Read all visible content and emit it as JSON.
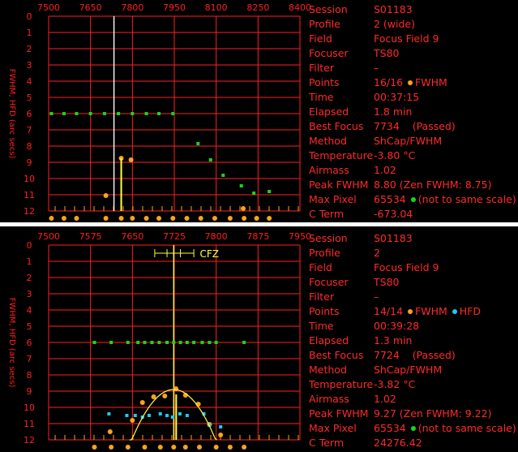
{
  "colors": {
    "grid": "#ff1f1f",
    "fwhm": "#ffa31a",
    "hfd": "#1ec8ff",
    "flux": "#19d619",
    "marker": "#ffff40",
    "focus_line": "#ffffff"
  },
  "top": {
    "info": [
      {
        "key": "Session",
        "val": "S01183"
      },
      {
        "key": "Profile",
        "val": "2 (wide)"
      },
      {
        "key": "Field",
        "val": "Focus Field 9"
      },
      {
        "key": "Focuser",
        "val": "TS80"
      },
      {
        "key": "Filter",
        "val": "–"
      },
      {
        "key": "Points",
        "val": "16/16",
        "legend1": "FWHM"
      },
      {
        "key": "Time",
        "val": "00:37:15"
      },
      {
        "key": "Elapsed",
        "val": "1.8 min"
      },
      {
        "key": "Best Focus",
        "val": "7734    (Passed)"
      },
      {
        "key": "Method",
        "val": "ShCap/FWHM"
      },
      {
        "key": "Temperature",
        "val": "-3.80 °C"
      },
      {
        "key": "Airmass",
        "val": "1.02"
      },
      {
        "key": "Peak FWHM",
        "val": "8.80 (Zen FWHM: 8.75)"
      },
      {
        "key": "Max Pixel",
        "val": "65534",
        "note": "(not to same scale)"
      },
      {
        "key": "C Term",
        "val": "-673.04"
      }
    ]
  },
  "bottom": {
    "info": [
      {
        "key": "Session",
        "val": "S01183"
      },
      {
        "key": "Profile",
        "val": "2"
      },
      {
        "key": "Field",
        "val": "Focus Field 9"
      },
      {
        "key": "Focuser",
        "val": "TS80"
      },
      {
        "key": "Filter",
        "val": "–"
      },
      {
        "key": "Points",
        "val": "14/14",
        "legend1": "FWHM",
        "legend2": "HFD"
      },
      {
        "key": "Time",
        "val": "00:39:28"
      },
      {
        "key": "Elapsed",
        "val": "1.3 min"
      },
      {
        "key": "Best Focus",
        "val": "7724    (Passed)"
      },
      {
        "key": "Method",
        "val": "ShCap/FWHM"
      },
      {
        "key": "Temperature",
        "val": "-3.82 °C"
      },
      {
        "key": "Airmass",
        "val": "1.02"
      },
      {
        "key": "Peak FWHM",
        "val": "9.27 (Zen FWHM: 9.22)"
      },
      {
        "key": "Max Pixel",
        "val": "65534",
        "note": "(not to same scale)"
      },
      {
        "key": "C Term",
        "val": "24276.42"
      }
    ]
  },
  "chart_data": [
    {
      "type": "scatter",
      "ylabel": "FWHM, HFD (arc secs)",
      "xlim": [
        7500,
        8400
      ],
      "xticks": [
        7500,
        7650,
        7800,
        7950,
        8100,
        8250,
        8400
      ],
      "ylim": [
        0,
        12
      ],
      "yticks": [
        0,
        1,
        2,
        3,
        4,
        5,
        6,
        7,
        8,
        9,
        10,
        11,
        12
      ],
      "best_focus": 7734,
      "series": [
        {
          "name": "FWHM",
          "points": [
            [
              7705,
              11.05
            ],
            [
              7760,
              8.75
            ],
            [
              7795,
              8.85
            ],
            [
              8197,
              11.85
            ]
          ]
        },
        {
          "name": "Flux",
          "points": [
            [
              7510,
              6
            ],
            [
              7555,
              6
            ],
            [
              7600,
              6
            ],
            [
              7650,
              6
            ],
            [
              7700,
              6
            ],
            [
              7750,
              6
            ],
            [
              7800,
              6
            ],
            [
              7850,
              6
            ],
            [
              7895,
              6
            ],
            [
              7945,
              6
            ],
            [
              8035,
              7.85
            ],
            [
              8080,
              8.85
            ],
            [
              8125,
              9.8
            ],
            [
              8190,
              10.45
            ],
            [
              8235,
              10.9
            ],
            [
              8290,
              10.8
            ]
          ]
        }
      ],
      "position_markers": [
        7510,
        7555,
        7600,
        7705,
        7760,
        7800,
        7850,
        7895,
        7945,
        7995,
        8045,
        8095,
        8150,
        8200,
        8245,
        8290
      ]
    },
    {
      "type": "scatter",
      "ylabel": "FWHM, HFD (arc secs)",
      "xlim": [
        7500,
        7950
      ],
      "xticks": [
        7500,
        7575,
        7650,
        7725,
        7800,
        7875,
        7950
      ],
      "ylim": [
        0,
        12
      ],
      "yticks": [
        0,
        1,
        2,
        3,
        4,
        5,
        6,
        7,
        8,
        9,
        10,
        11,
        12
      ],
      "best_focus": 7724,
      "cfz_label": "CFZ",
      "series": [
        {
          "name": "FWHM",
          "points": [
            [
              7610,
              11.5
            ],
            [
              7650,
              10.8
            ],
            [
              7668,
              9.7
            ],
            [
              7688,
              9.35
            ],
            [
              7708,
              9.3
            ],
            [
              7728,
              8.85
            ],
            [
              7745,
              9.25
            ],
            [
              7768,
              9.8
            ],
            [
              7788,
              11.05
            ],
            [
              7808,
              11.7
            ]
          ]
        },
        {
          "name": "HFD",
          "points": [
            [
              7608,
              10.4
            ],
            [
              7640,
              10.5
            ],
            [
              7655,
              10.5
            ],
            [
              7668,
              10.6
            ],
            [
              7680,
              10.5
            ],
            [
              7700,
              10.4
            ],
            [
              7712,
              10.5
            ],
            [
              7722,
              10.6
            ],
            [
              7735,
              10.4
            ],
            [
              7748,
              10.5
            ],
            [
              7778,
              10.4
            ],
            [
              7788,
              11.1
            ],
            [
              7808,
              11.2
            ]
          ]
        },
        {
          "name": "Flux",
          "points": [
            [
              7582,
              6
            ],
            [
              7612,
              6
            ],
            [
              7642,
              6
            ],
            [
              7660,
              6
            ],
            [
              7672,
              6
            ],
            [
              7685,
              6
            ],
            [
              7698,
              6
            ],
            [
              7712,
              6
            ],
            [
              7724,
              6
            ],
            [
              7736,
              6
            ],
            [
              7748,
              6
            ],
            [
              7760,
              6
            ],
            [
              7775,
              6
            ],
            [
              7788,
              6
            ],
            [
              7800,
              6
            ],
            [
              7850,
              6
            ]
          ]
        }
      ],
      "position_markers": [
        7582,
        7612,
        7642,
        7672,
        7700,
        7724,
        7745,
        7770,
        7800,
        7825,
        7850
      ]
    }
  ]
}
